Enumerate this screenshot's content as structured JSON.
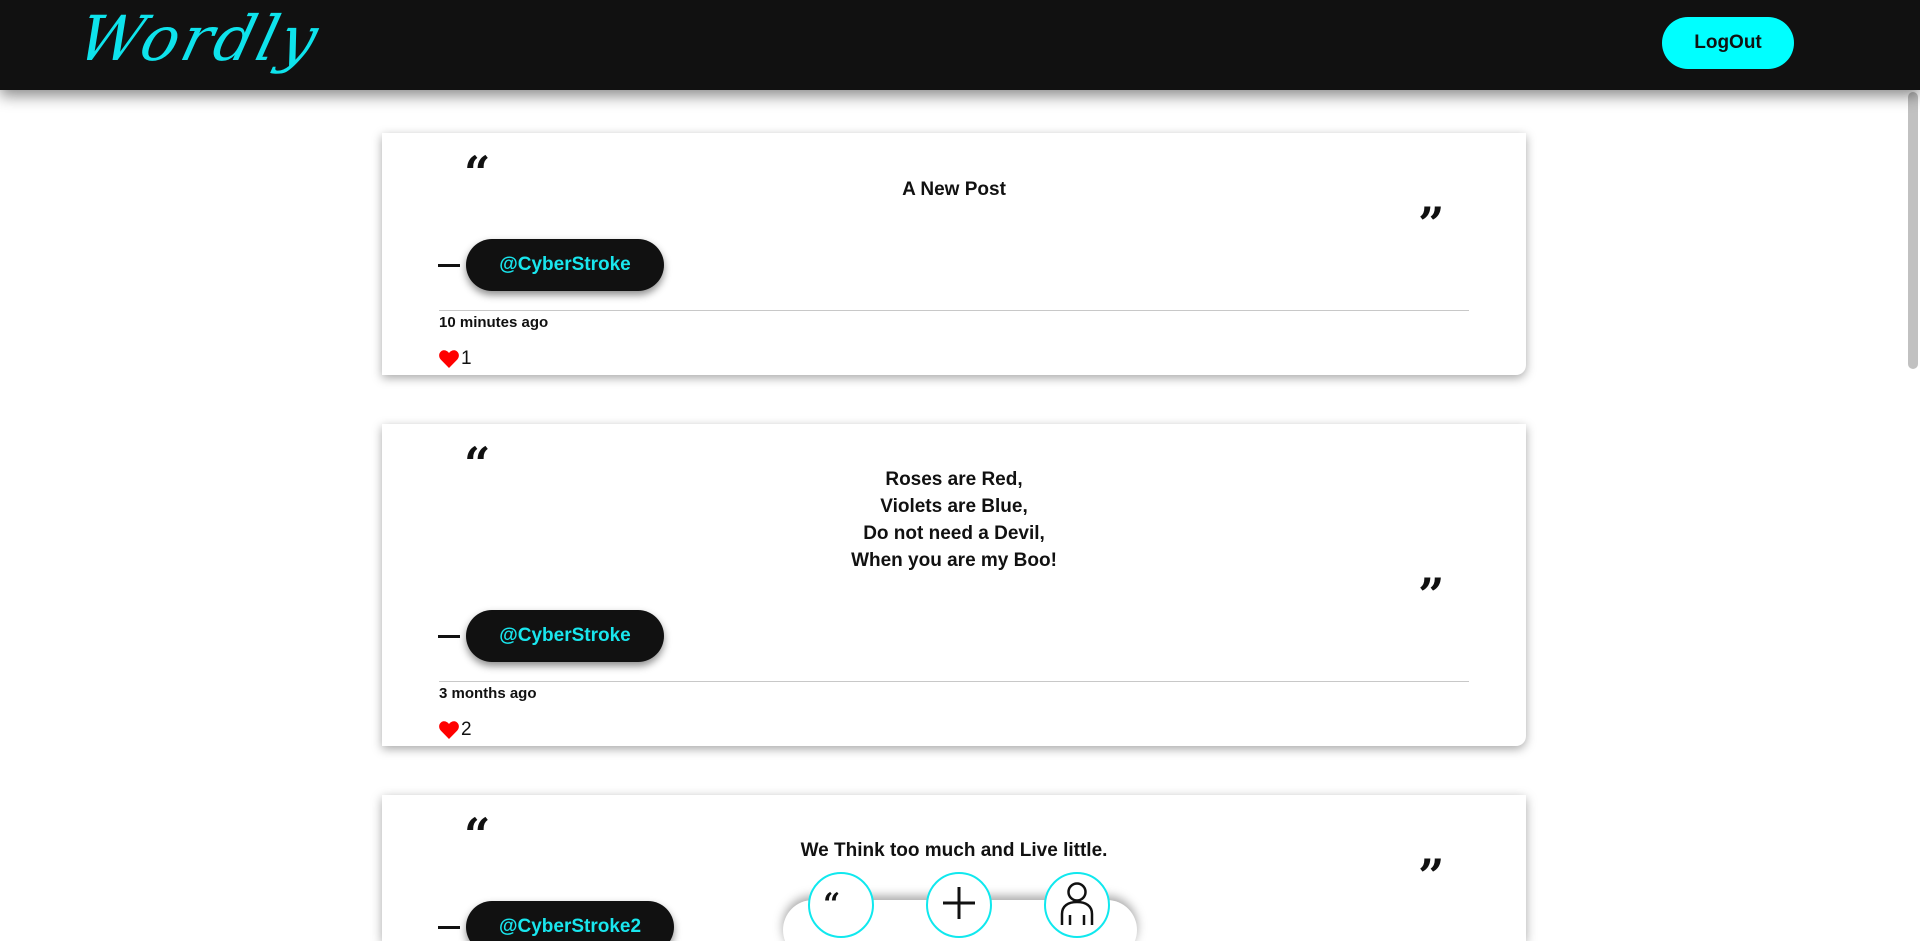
{
  "header": {
    "brand": "Wordly",
    "logout_label": "LogOut"
  },
  "posts": [
    {
      "text": "A New Post",
      "author": "@CyberStroke",
      "time": "10 minutes ago",
      "likes": "1"
    },
    {
      "text": "Roses are Red,\nViolets are Blue,\nDo not need a Devil,\nWhen you are my Boo!",
      "author": "@CyberStroke",
      "time": "3 months ago",
      "likes": "2"
    },
    {
      "text": "We Think too much and Live little.",
      "author": "@CyberStroke2"
    }
  ],
  "icons": {
    "quote_open": "“",
    "quote_close": "”",
    "heart": "heart-icon",
    "nav_quotes": "quotes-icon",
    "nav_add": "plus-icon",
    "nav_profile": "user-icon"
  },
  "colors": {
    "accent": "#00ffff",
    "header_bg": "#111111",
    "heart": "#ff0000"
  }
}
